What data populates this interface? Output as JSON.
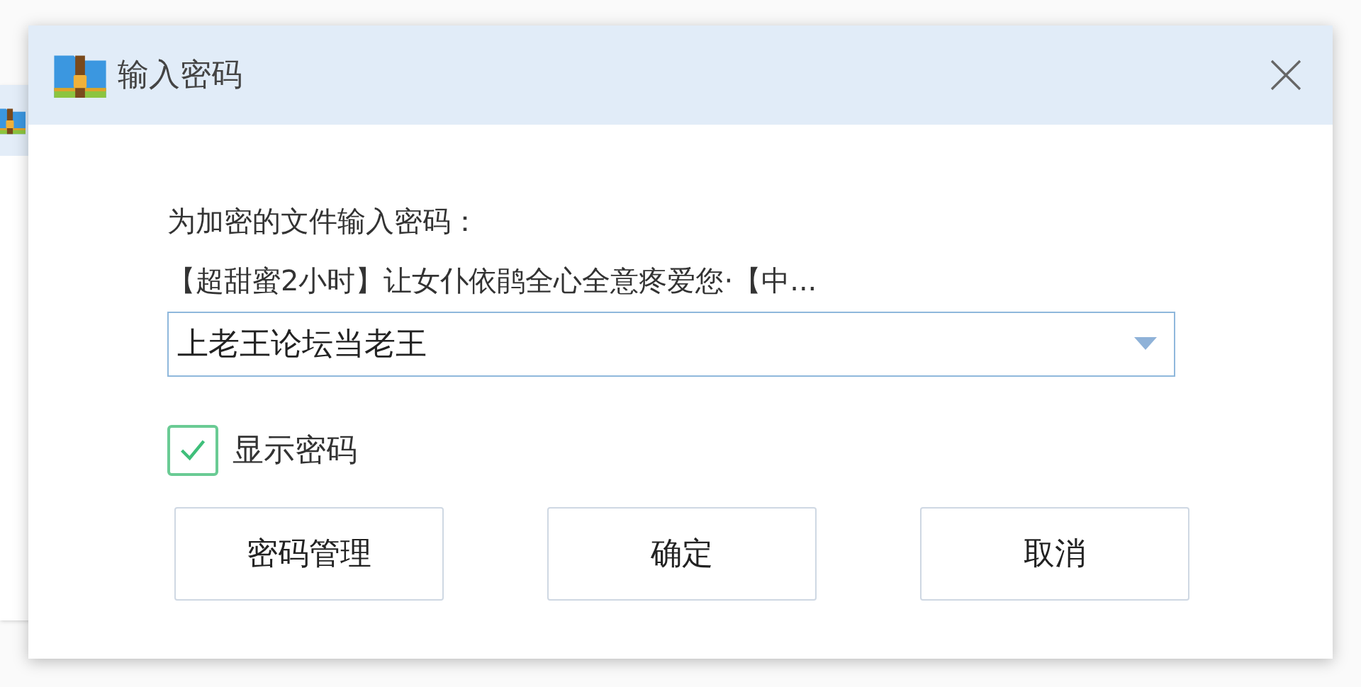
{
  "window": {
    "title": "输入密码"
  },
  "prompt": "为加密的文件输入密码：",
  "file_name": "【超甜蜜2小时】让女仆依鹃全心全意疼爱您·【中...",
  "password_field": {
    "value": "上老王论坛当老王"
  },
  "show_password": {
    "label": "显示密码",
    "checked": true
  },
  "buttons": [
    {
      "label": "密码管理"
    },
    {
      "label": "确定"
    },
    {
      "label": "取消"
    }
  ]
}
